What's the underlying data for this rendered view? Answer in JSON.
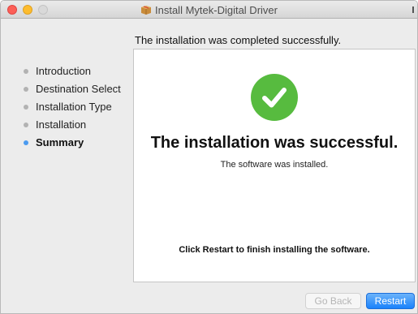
{
  "window": {
    "title": "Install Mytek-Digital Driver",
    "icon": "package-icon"
  },
  "header": {
    "status_text": "The installation was completed successfully."
  },
  "sidebar": {
    "steps": [
      {
        "label": "Introduction",
        "active": false
      },
      {
        "label": "Destination Select",
        "active": false
      },
      {
        "label": "Installation Type",
        "active": false
      },
      {
        "label": "Installation",
        "active": false
      },
      {
        "label": "Summary",
        "active": true
      }
    ]
  },
  "panel": {
    "icon": "checkmark-icon",
    "title": "The installation was successful.",
    "subtitle": "The software was installed.",
    "note": "Click Restart to finish installing the software."
  },
  "buttons": {
    "go_back": "Go Back",
    "restart": "Restart"
  },
  "colors": {
    "accent": "#1a82fb",
    "success": "#57bb3f",
    "active_step": "#4b9bf0"
  }
}
